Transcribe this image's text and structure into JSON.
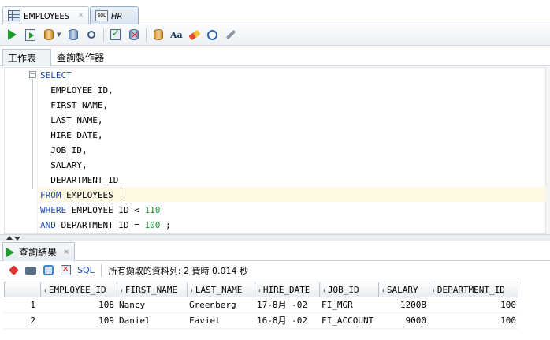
{
  "tabs": [
    {
      "label": "EMPLOYEES",
      "icon": "table-grid-icon"
    },
    {
      "label": "HR",
      "icon": "sql-worksheet-icon"
    }
  ],
  "toolbar": {
    "buttons": [
      "run-statement",
      "run-script",
      "autotrace",
      "explain-plan",
      "sql-tuning-advisor",
      "commit",
      "rollback",
      "unshared-sql",
      "to-upper-lower",
      "clear",
      "sql-history",
      "tools"
    ]
  },
  "subtabs": {
    "worksheet": "工作表",
    "query_builder": "查詢製作器"
  },
  "editor": {
    "lines": [
      {
        "kw": "SELECT",
        "rest": ""
      },
      {
        "kw": "",
        "rest": "  EMPLOYEE_ID,"
      },
      {
        "kw": "",
        "rest": "  FIRST_NAME,"
      },
      {
        "kw": "",
        "rest": "  LAST_NAME,"
      },
      {
        "kw": "",
        "rest": "  HIRE_DATE,"
      },
      {
        "kw": "",
        "rest": "  JOB_ID,"
      },
      {
        "kw": "",
        "rest": "  SALARY,"
      },
      {
        "kw": "",
        "rest": "  DEPARTMENT_ID"
      },
      {
        "kw": "FROM",
        "rest": " EMPLOYEES"
      },
      {
        "kw": "WHERE",
        "rest": " EMPLOYEE_ID < ",
        "num": "110",
        "tail": ""
      },
      {
        "kw": "AND",
        "rest": " DEPARTMENT_ID = ",
        "num": "100",
        "tail": " ;"
      }
    ]
  },
  "results": {
    "tab_label": "查詢結果",
    "tab_close": "×",
    "sql_label": "SQL",
    "status": "所有擷取的資料列: 2 費時 0.014 秒",
    "columns": [
      "EMPLOYEE_ID",
      "FIRST_NAME",
      "LAST_NAME",
      "HIRE_DATE",
      "JOB_ID",
      "SALARY",
      "DEPARTMENT_ID"
    ],
    "rows": [
      {
        "num": "1",
        "cells": [
          "108",
          "Nancy",
          "Greenberg",
          "17-8月 -02",
          "FI_MGR",
          "12008",
          "100"
        ]
      },
      {
        "num": "2",
        "cells": [
          "109",
          "Daniel",
          "Faviet",
          "16-8月 -02",
          "FI_ACCOUNT",
          "9000",
          "100"
        ]
      }
    ]
  }
}
